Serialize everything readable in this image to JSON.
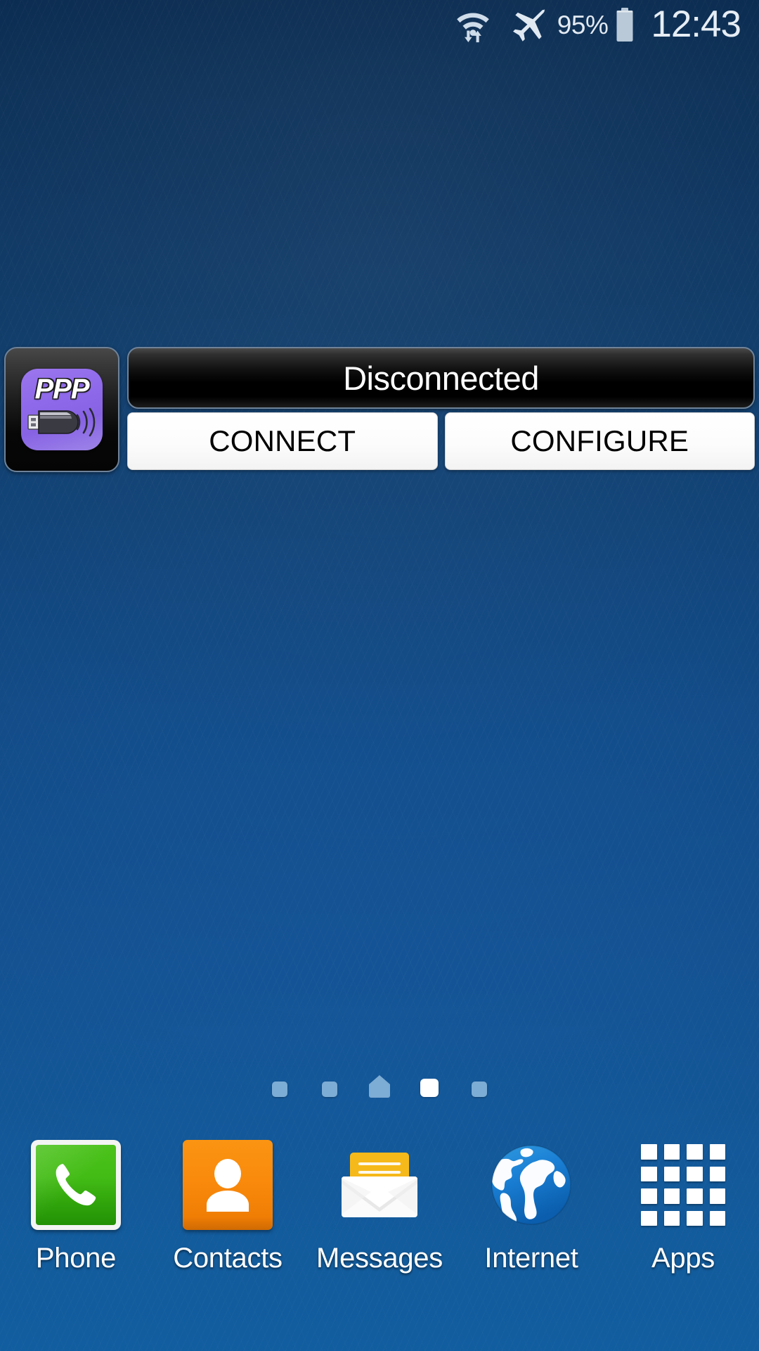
{
  "status_bar": {
    "wifi_icon": "wifi-transfer-icon",
    "airplane_icon": "airplane-mode-icon",
    "battery_percent": "95%",
    "battery_icon": "battery-icon",
    "clock": "12:43"
  },
  "widget": {
    "app_icon_label": "PPP",
    "app_icon_name": "ppp-widget-usb-modem-icon",
    "status": "Disconnected",
    "buttons": [
      {
        "label": "CONNECT",
        "name": "connect-button"
      },
      {
        "label": "CONFIGURE",
        "name": "configure-button"
      }
    ]
  },
  "page_indicator": {
    "count": 5,
    "active_index": 3,
    "home_index": 2
  },
  "dock": {
    "items": [
      {
        "label": "Phone",
        "icon": "phone-icon"
      },
      {
        "label": "Contacts",
        "icon": "contacts-icon"
      },
      {
        "label": "Messages",
        "icon": "messages-icon"
      },
      {
        "label": "Internet",
        "icon": "internet-globe-icon"
      },
      {
        "label": "Apps",
        "icon": "apps-grid-icon"
      }
    ]
  },
  "colors": {
    "wallpaper_top": "#0b2c51",
    "wallpaper_bottom": "#1368b1",
    "widget_accent": "#8f6aea",
    "phone_green": "#43bc16",
    "contacts_orange": "#f98a0c",
    "messages_yellow": "#f6b91a",
    "internet_blue": "#1a7fd4",
    "status_text": "#ffffff"
  }
}
